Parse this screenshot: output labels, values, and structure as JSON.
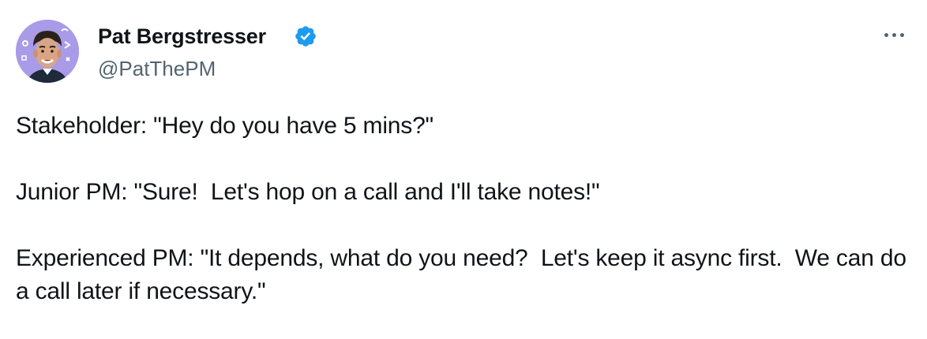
{
  "author": {
    "display_name": "Pat Bergstresser",
    "handle": "@PatThePM",
    "verified": true,
    "avatar_icon": "profile-photo",
    "verified_icon": "verified-badge-icon"
  },
  "menu": {
    "icon": "more-options-icon"
  },
  "tweet": {
    "paragraphs": [
      "Stakeholder: \"Hey do you have 5 mins?\"",
      "Junior PM: \"Sure!  Let's hop on a call and I'll take notes!\"",
      "Experienced PM: \"It depends, what do you need?  Let's keep it async first.  We can do a call later if necessary.\""
    ]
  },
  "colors": {
    "text": "#0f1419",
    "secondary_text": "#536471",
    "verified_blue": "#1d9bf0",
    "avatar_bg": "#a99be8"
  }
}
